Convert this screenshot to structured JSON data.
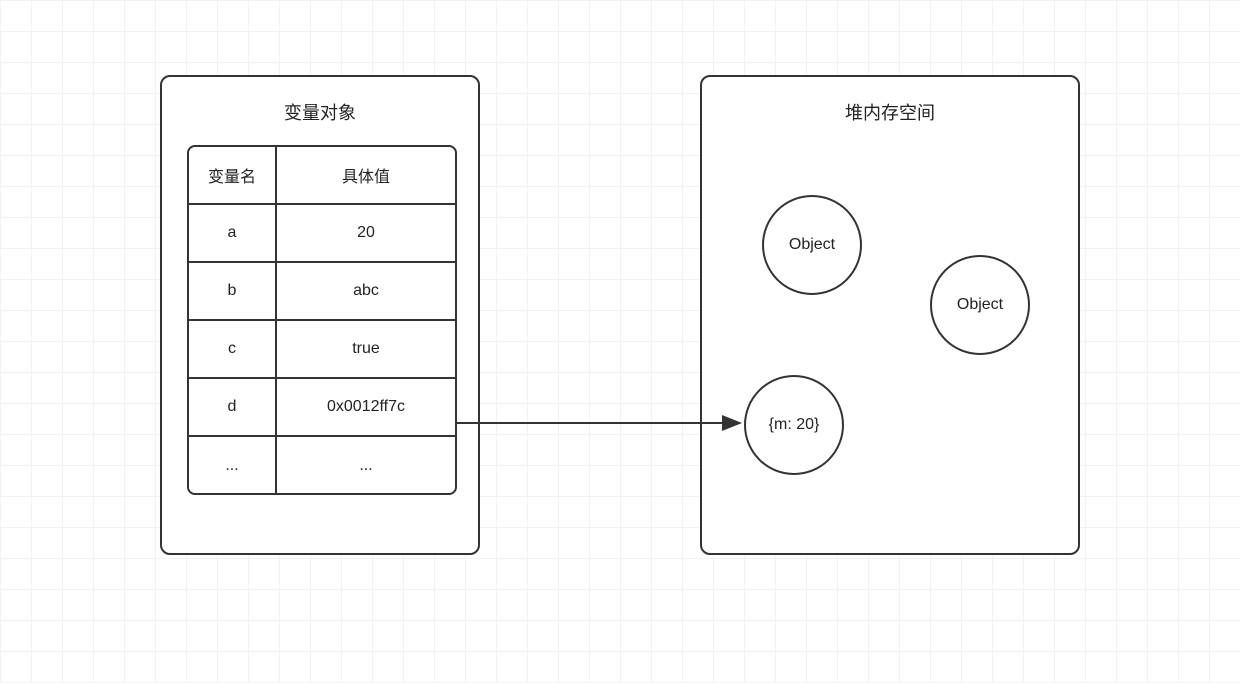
{
  "left": {
    "title": "变量对象",
    "table": {
      "headers": {
        "name": "变量名",
        "value": "具体值"
      },
      "rows": [
        {
          "name": "a",
          "value": "20"
        },
        {
          "name": "b",
          "value": "abc"
        },
        {
          "name": "c",
          "value": "true"
        },
        {
          "name": "d",
          "value": "0x0012ff7c"
        },
        {
          "name": "...",
          "value": "..."
        }
      ]
    }
  },
  "right": {
    "title": "堆内存空间",
    "objects": [
      {
        "label": "Object"
      },
      {
        "label": "Object"
      },
      {
        "label": "{m: 20}"
      }
    ]
  },
  "arrow": {
    "from": "left.table.rows.3.value",
    "to": "right.objects.2"
  }
}
